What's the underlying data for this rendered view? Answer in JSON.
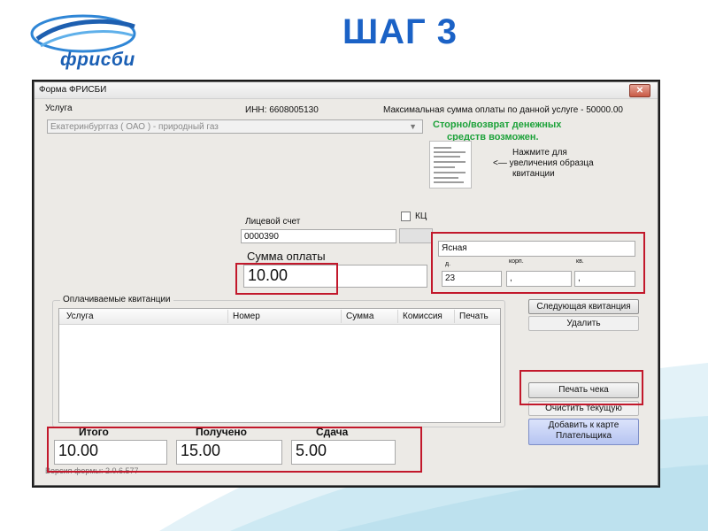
{
  "slide": {
    "logo_text": "фрисби",
    "title": "ШАГ 3"
  },
  "window": {
    "title": "Форма ФРИСБИ",
    "close_icon": "close-icon"
  },
  "service": {
    "label": "Услуга",
    "inn": "ИНН: 6608005130",
    "max_sum": "Максимальная сумма оплаты по данной услуге - 50000.00",
    "value": "Екатеринбурггаз ( ОАО ) - природный газ",
    "refund_line1": "Сторно/возврат денежных",
    "refund_line2": "средств возможен.",
    "hint_line1": "Нажмите для",
    "hint_line2": "<— увеличения образца",
    "hint_line3": "квитанции"
  },
  "account": {
    "label": "Лицевой счет",
    "value": "0000390",
    "kc_label": "КЦ"
  },
  "payment": {
    "label": "Сумма оплаты",
    "value": "10.00"
  },
  "address": {
    "street": "Ясная",
    "house_label": "д.",
    "corp_label": "корп.",
    "flat_label": "кв.",
    "house": "23",
    "corp": ",",
    "flat": ","
  },
  "receipts": {
    "legend": "Оплачиваемые квитанции",
    "columns": [
      "Услуга",
      "Номер",
      "Сумма",
      "Комиссия",
      "Печать"
    ]
  },
  "buttons": {
    "next": "Следующая квитанция",
    "delete": "Удалить",
    "print": "Печать чека",
    "clear": "Очистить текущую",
    "add_card_line1": "Добавить к карте",
    "add_card_line2": "Плательщика"
  },
  "totals": {
    "itogo_label": "Итого",
    "received_label": "Получено",
    "change_label": "Сдача",
    "itogo": "10.00",
    "received": "15.00",
    "change": "5.00"
  },
  "version": "Версия формы: 2.0.6.577",
  "colors": {
    "title_blue": "#1b62c6",
    "highlight_red": "#c2182b",
    "status_green": "#1da23a"
  }
}
